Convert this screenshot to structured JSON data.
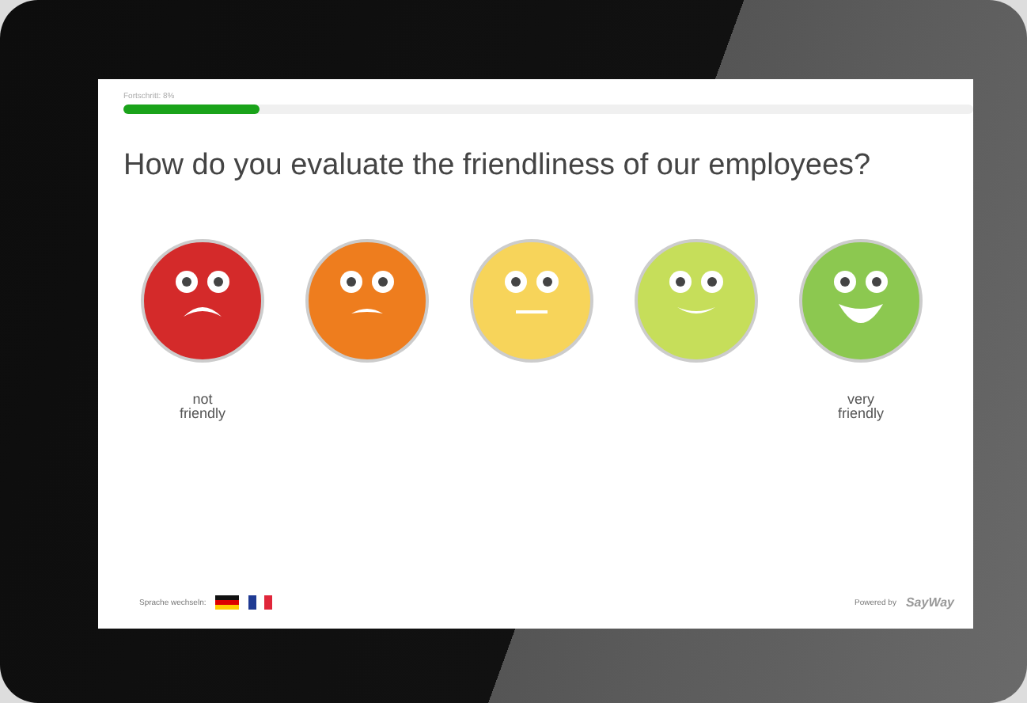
{
  "progress": {
    "label": "Fortschritt: 8%",
    "level": 0.16
  },
  "question": "How do you evaluate the friendliness of our employees?",
  "faces": [
    {
      "kind": "sad",
      "color": "#d42a2a",
      "label": "not friendly"
    },
    {
      "kind": "frown",
      "color": "#ee7d1e"
    },
    {
      "kind": "neutral",
      "color": "#f7d45a"
    },
    {
      "kind": "smile",
      "color": "#c6de5a"
    },
    {
      "kind": "grin",
      "color": "#8cc850",
      "label": "very friendly"
    }
  ],
  "footer": {
    "language_label": "Sprache wechseln:",
    "languages": [
      {
        "kind": "de"
      },
      {
        "kind": "fr"
      }
    ],
    "powered_label": "Powered by",
    "brand": "SayWay"
  }
}
